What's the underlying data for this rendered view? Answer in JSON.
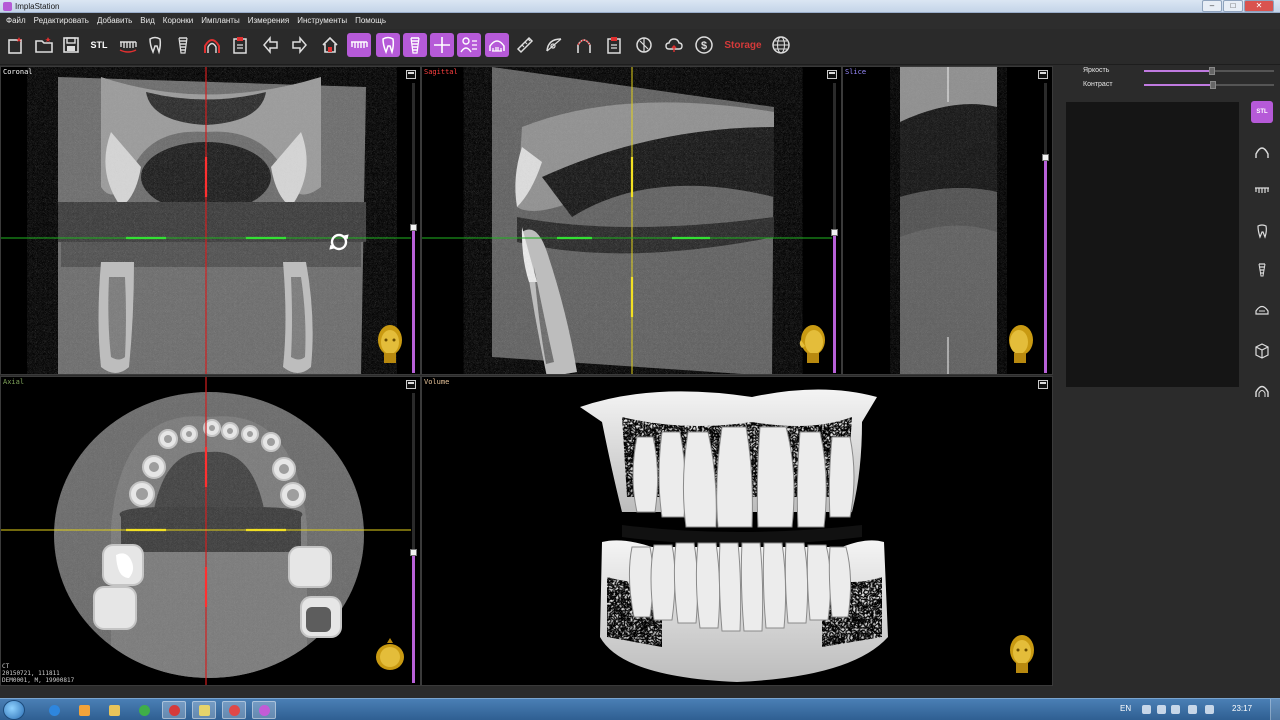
{
  "window": {
    "title": "ImplaStation"
  },
  "menu": [
    "Файл",
    "Редактировать",
    "Добавить",
    "Вид",
    "Коронки",
    "Импланты",
    "Измерения",
    "Инструменты",
    "Помощь"
  ],
  "toolbar": {
    "stl_label": "STL",
    "storage_label": "Storage",
    "active_tools": [
      "panoramic-teeth",
      "tooth",
      "implant",
      "crosshair",
      "patient-info",
      "arch-view"
    ]
  },
  "viewports": {
    "coronal": {
      "label": "Coronal",
      "label_color": "#ffffff"
    },
    "sagittal": {
      "label": "Sagittal",
      "label_color": "#ff4040"
    },
    "slice": {
      "label": "Slice",
      "label_color": "#9a8cff"
    },
    "axial": {
      "label": "Axial",
      "label_color": "#7fa35a",
      "info_lines": [
        "CT",
        "20150721, 111811",
        "DEM0001, M, 19900817"
      ]
    },
    "volume": {
      "label": "Volume",
      "label_color": "#e8c49a"
    }
  },
  "right_panel": {
    "brightness_label": "Яркость",
    "brightness_value": 0.52,
    "contrast_label": "Контраст",
    "contrast_value": 0.53,
    "stl_label": "STL"
  },
  "taskbar": {
    "language": "EN",
    "clock": "23:17"
  },
  "colors": {
    "accent": "#b65ad8",
    "crosshair_red": "#d21e1e",
    "crosshair_green": "#1fb31f",
    "crosshair_yellow": "#e3d21a"
  }
}
